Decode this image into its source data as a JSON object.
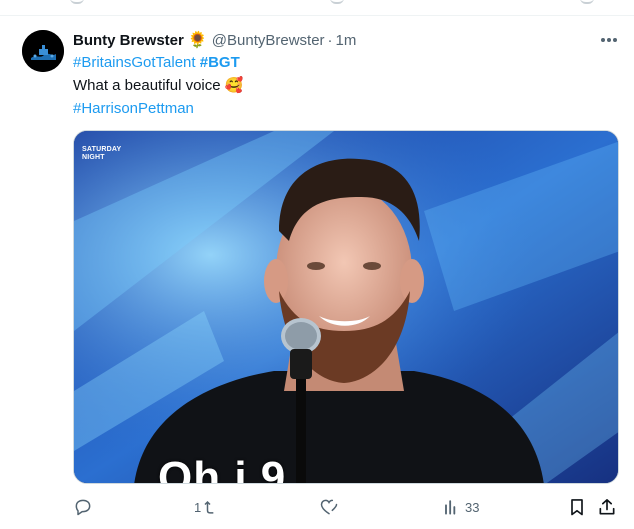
{
  "tweet": {
    "display_name": "Bunty Brewster",
    "name_emoji": "🌻",
    "handle": "@BuntyBrewster",
    "separator": "·",
    "time": "1m",
    "hashtag_1": "#BritainsGotTalent",
    "hashtag_2": "#BGT",
    "text": "What a beautiful voice",
    "text_emoji": "🥰",
    "hashtag_3": "#HarrisonPettman"
  },
  "media": {
    "watermark_line1": "SATURDAY",
    "watermark_line2": "NIGHT",
    "subtitle": "Oh i  9"
  },
  "actions": {
    "reply_count": "",
    "retweet_count": "1",
    "like_count": "",
    "views_count": "33"
  },
  "icons": {
    "reply": "reply-icon",
    "retweet": "retweet-icon",
    "like": "heart-icon",
    "views": "views-icon",
    "bookmark": "bookmark-icon",
    "share": "share-icon",
    "more": "more-icon"
  },
  "colors": {
    "accent": "#1d9bf0",
    "text": "#0f1419",
    "secondary": "#536471"
  }
}
